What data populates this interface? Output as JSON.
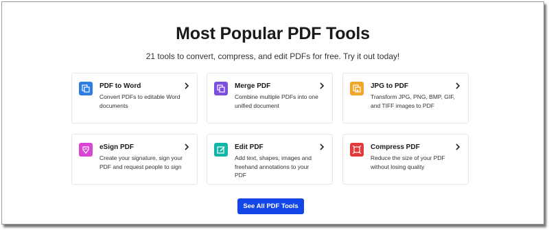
{
  "header": {
    "title": "Most Popular PDF Tools",
    "subtitle": "21 tools to convert, compress, and edit PDFs for free. Try it out today!"
  },
  "tools": [
    {
      "title": "PDF to Word",
      "desc": "Convert PDFs to editable Word documents",
      "icon": "word-convert-icon",
      "color": "#2d7de4"
    },
    {
      "title": "Merge PDF",
      "desc": "Combine multiple PDFs into one unified document",
      "icon": "merge-icon",
      "color": "#7d4fe0"
    },
    {
      "title": "JPG to PDF",
      "desc": "Transform JPG, PNG, BMP, GIF, and TIFF images to PDF",
      "icon": "image-convert-icon",
      "color": "#f2a52b"
    },
    {
      "title": "eSign PDF",
      "desc": "Create your signature, sign your PDF and request people to sign",
      "icon": "signature-icon",
      "color": "#d946d4"
    },
    {
      "title": "Edit PDF",
      "desc": "Add text, shapes, images and freehand annotations to your PDF",
      "icon": "edit-icon",
      "color": "#12b5a6"
    },
    {
      "title": "Compress PDF",
      "desc": "Reduce the size of your PDF without losing quality",
      "icon": "compress-icon",
      "color": "#e23a3a"
    }
  ],
  "cta": {
    "label": "See All PDF Tools",
    "color": "#1346e8"
  }
}
